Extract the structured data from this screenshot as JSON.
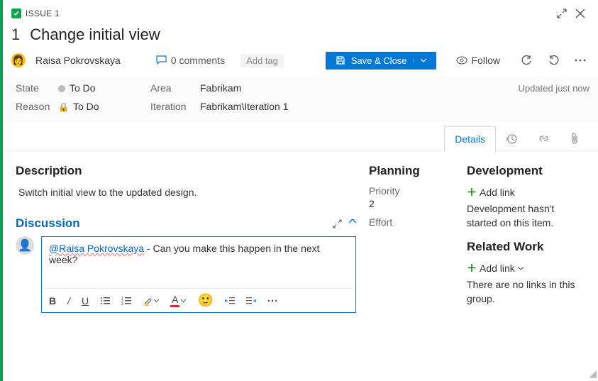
{
  "header": {
    "type": "ISSUE 1",
    "id": "1",
    "title": "Change initial view"
  },
  "assignee": "Raisa Pokrovskaya",
  "comments": {
    "count": "0",
    "label": "0 comments"
  },
  "addTag": "Add tag",
  "save": "Save & Close",
  "follow": "Follow",
  "fields": {
    "stateLabel": "State",
    "stateValue": "To Do",
    "reasonLabel": "Reason",
    "reasonValue": "To Do",
    "areaLabel": "Area",
    "areaValue": "Fabrikam",
    "iterationLabel": "Iteration",
    "iterationValue": "Fabrikam\\Iteration 1",
    "updated": "Updated just now"
  },
  "tabs": {
    "details": "Details"
  },
  "description": {
    "heading": "Description",
    "text": "Switch initial view to the updated design."
  },
  "discussion": {
    "heading": "Discussion",
    "mention": "@Raisa Pokrovskaya",
    "rest": " - Can you make this happen in the next week?"
  },
  "planning": {
    "heading": "Planning",
    "priorityLabel": "Priority",
    "priorityValue": "2",
    "effortLabel": "Effort"
  },
  "development": {
    "heading": "Development",
    "addLink": "Add link",
    "text": "Development hasn't started on this item."
  },
  "related": {
    "heading": "Related Work",
    "addLink": "Add link",
    "text": "There are no links in this group."
  }
}
